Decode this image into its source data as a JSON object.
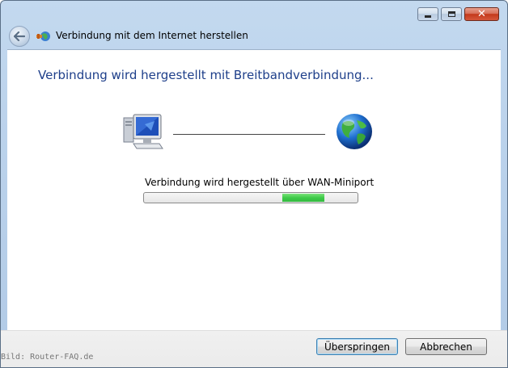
{
  "window": {
    "title": "Verbindung mit dem Internet herstellen",
    "caption_buttons": {
      "minimize_icon": "minimize-icon",
      "maximize_icon": "maximize-icon",
      "close_icon": "close-icon",
      "close_glyph": "✕"
    }
  },
  "navigation": {
    "back_icon": "back-arrow-icon",
    "app_icon": "network-connection-icon"
  },
  "main": {
    "heading": "Verbindung wird hergestellt mit Breitbandverbindung...",
    "source_icon": "computer-icon",
    "target_icon": "globe-icon",
    "status_text": "Verbindung wird hergestellt über WAN-Miniport",
    "progress": {
      "type": "marquee",
      "fill_color": "#3fcb4a"
    }
  },
  "footer": {
    "watermark": "Bild: Router-FAQ.de",
    "skip_button": "Überspringen",
    "cancel_button": "Abbrechen"
  },
  "colors": {
    "heading": "#1e3f8a",
    "chrome": "#bcd3ec",
    "footer": "#f0f0f0"
  }
}
